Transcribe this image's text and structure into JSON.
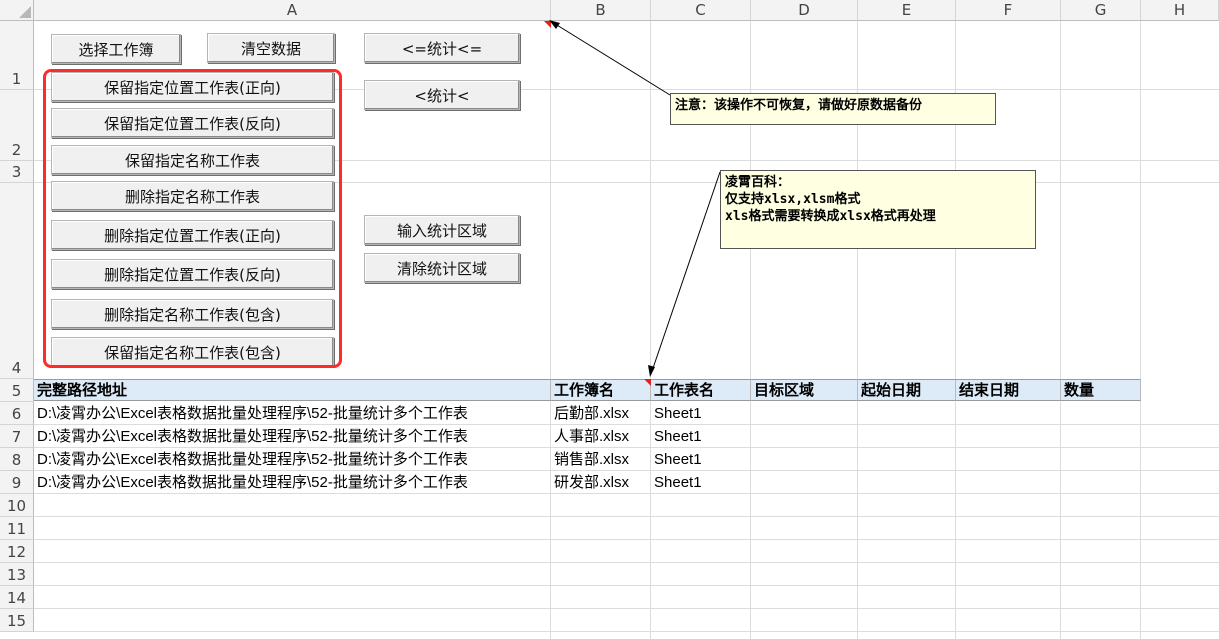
{
  "columns": [
    "A",
    "B",
    "C",
    "D",
    "E",
    "F",
    "G",
    "H"
  ],
  "rows": [
    "1",
    "2",
    "3",
    "4",
    "5",
    "6",
    "7",
    "8",
    "9",
    "10",
    "11",
    "12",
    "13",
    "14",
    "15"
  ],
  "buttons": {
    "select_workbook": "选择工作簿",
    "clear_data": "清空数据",
    "stat_left": "<=统计<=",
    "stat": "<统计<",
    "keep_pos_forward": "保留指定位置工作表(正向)",
    "keep_pos_reverse": "保留指定位置工作表(反向)",
    "keep_name": "保留指定名称工作表",
    "delete_name": "删除指定名称工作表",
    "delete_pos_forward": "删除指定位置工作表(正向)",
    "delete_pos_reverse": "删除指定位置工作表(反向)",
    "delete_name_contains": "删除指定名称工作表(包含)",
    "keep_name_contains": "保留指定名称工作表(包含)",
    "input_range": "输入统计区域",
    "clear_range": "清除统计区域"
  },
  "notes": {
    "warning": "注意：该操作不可恢复，请做好原数据备份",
    "info_line1": "凌霄百科：",
    "info_line2": "仅支持xlsx,xlsm格式",
    "info_line3": "xls格式需要转换成xlsx格式再处理"
  },
  "table": {
    "headers": [
      "完整路径地址",
      "工作簿名",
      "工作表名",
      "目标区域",
      "起始日期",
      "结束日期",
      "数量"
    ],
    "rows": [
      {
        "path": "D:\\凌霄办公\\Excel表格数据批量处理程序\\52-批量统计多个工作表",
        "workbook": "后勤部.xlsx",
        "sheet": "Sheet1"
      },
      {
        "path": "D:\\凌霄办公\\Excel表格数据批量处理程序\\52-批量统计多个工作表",
        "workbook": "人事部.xlsx",
        "sheet": "Sheet1"
      },
      {
        "path": "D:\\凌霄办公\\Excel表格数据批量处理程序\\52-批量统计多个工作表",
        "workbook": "销售部.xlsx",
        "sheet": "Sheet1"
      },
      {
        "path": "D:\\凌霄办公\\Excel表格数据批量处理程序\\52-批量统计多个工作表",
        "workbook": "研发部.xlsx",
        "sheet": "Sheet1"
      }
    ]
  },
  "colors": {
    "highlight_box": "#ff2a2a",
    "header_fill": "#dcebf7",
    "note_fill": "#ffffe1"
  }
}
